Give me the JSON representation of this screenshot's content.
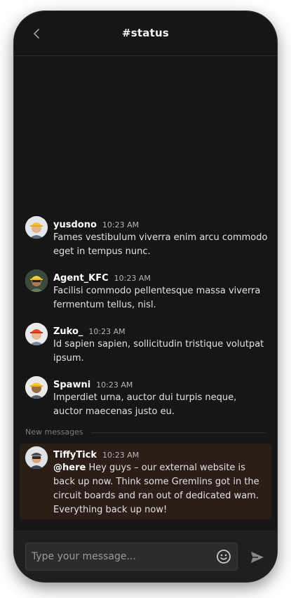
{
  "header": {
    "title": "#status",
    "back_icon": "chevron-left-icon"
  },
  "messages": [
    {
      "username": "yusdono",
      "time": "10:23 AM",
      "text": "Fames vestibulum viverra enim arcu commodo eget in tempus nunc.",
      "avatar": "avatar-yusdono"
    },
    {
      "username": "Agent_KFC",
      "time": "10:23 AM",
      "text": "Facilisi commodo pellentesque massa viverra fermentum tellus, nisl.",
      "avatar": "avatar-agent-kfc"
    },
    {
      "username": "Zuko_",
      "time": "10:23 AM",
      "text": "Id sapien sapien, sollicitudin tristique volutpat ipsum.",
      "avatar": "avatar-zuko"
    },
    {
      "username": "Spawni",
      "time": "10:23 AM",
      "text": "Imperdiet urna, auctor dui turpis neque, auctor maecenas justo eu.",
      "avatar": "avatar-spawni"
    }
  ],
  "divider": {
    "label": "New messages"
  },
  "highlighted_message": {
    "username": "TiffyTick",
    "time": "10:23 AM",
    "mention": "@here",
    "text": " Hey guys – our external website is back up now. Think some Gremlins got in the circuit boards and ran out of dedicated wam. Everything back up now!",
    "avatar": "avatar-tiffytick"
  },
  "composer": {
    "placeholder": "Type your message...",
    "emoji_icon": "smiley-icon",
    "send_icon": "send-icon"
  },
  "colors": {
    "background": "#161616",
    "highlight": "#2a1e16",
    "text": "#e2e2e2"
  }
}
